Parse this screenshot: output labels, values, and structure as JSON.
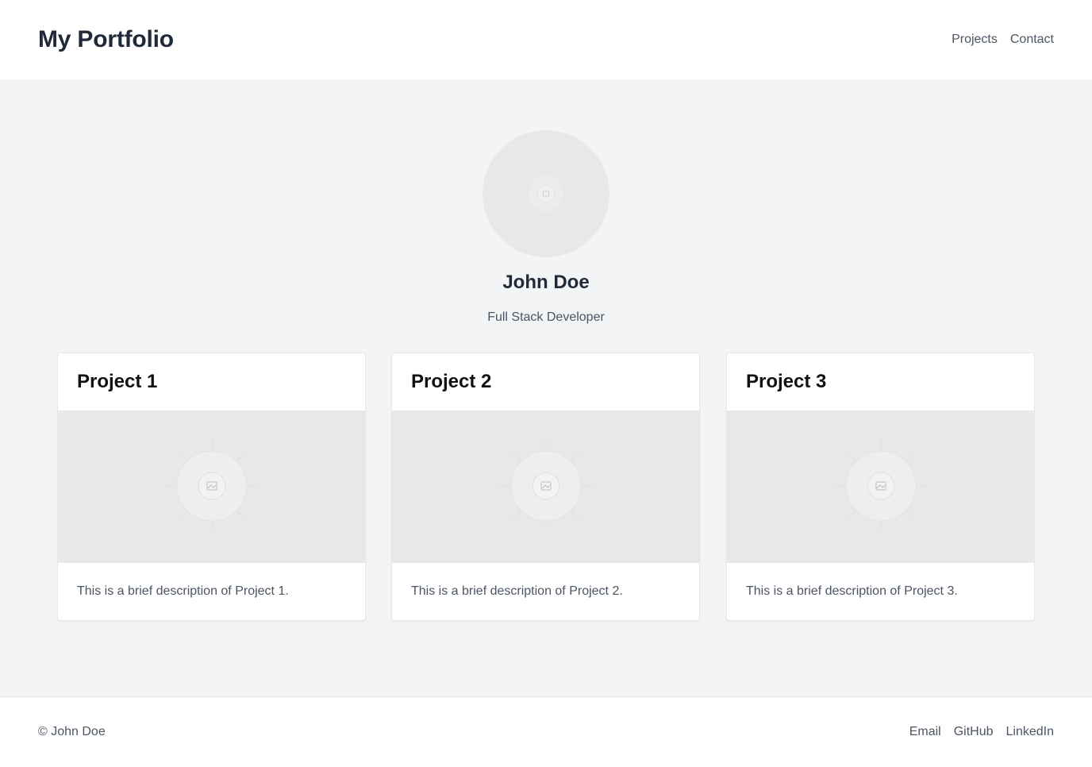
{
  "header": {
    "title": "My Portfolio",
    "nav": [
      {
        "label": "Projects"
      },
      {
        "label": "Contact"
      }
    ]
  },
  "profile": {
    "avatar_icon": "image-placeholder-icon",
    "name": "John Doe",
    "role": "Full Stack Developer"
  },
  "projects": [
    {
      "title": "Project 1",
      "image_icon": "image-placeholder-icon",
      "description": "This is a brief description of Project 1."
    },
    {
      "title": "Project 2",
      "image_icon": "image-placeholder-icon",
      "description": "This is a brief description of Project 2."
    },
    {
      "title": "Project 3",
      "image_icon": "image-placeholder-icon",
      "description": "This is a brief description of Project 3."
    }
  ],
  "footer": {
    "copyright": "© John Doe",
    "links": [
      {
        "label": "Email"
      },
      {
        "label": "GitHub"
      },
      {
        "label": "LinkedIn"
      }
    ]
  },
  "colors": {
    "page_background": "#f3f4f6",
    "surface": "#ffffff",
    "heading_text": "#1f2937",
    "muted_text": "#4b5563",
    "placeholder": "#e8e8e8"
  }
}
